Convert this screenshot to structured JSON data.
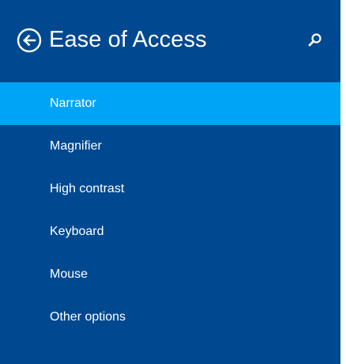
{
  "header": {
    "title": "Ease of Access",
    "back_icon": "back-arrow-circle-icon",
    "search_icon": "search-icon"
  },
  "nav": {
    "selected_index": 0,
    "items": [
      {
        "label": "Narrator"
      },
      {
        "label": "Magnifier"
      },
      {
        "label": "High contrast"
      },
      {
        "label": "Keyboard"
      },
      {
        "label": "Mouse"
      },
      {
        "label": "Other options"
      }
    ]
  },
  "colors": {
    "panel_background": "#004990",
    "selected_background": "#00a4f6",
    "text": "#ffffff",
    "page_background": "#ffffff"
  }
}
